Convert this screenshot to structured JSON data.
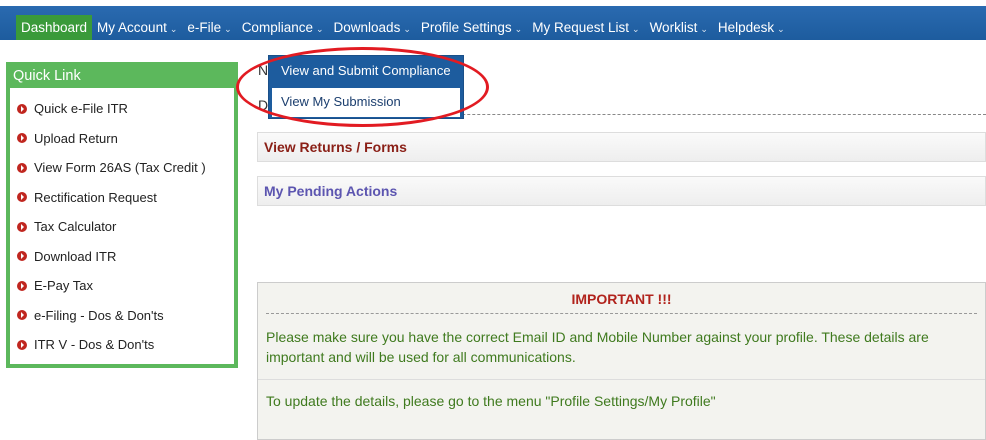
{
  "nav": {
    "items": [
      {
        "label": "Dashboard",
        "caret": ""
      },
      {
        "label": "My Account",
        "caret": "⌄"
      },
      {
        "label": "e-File",
        "caret": "⌄"
      },
      {
        "label": "Compliance",
        "caret": "⌄"
      },
      {
        "label": "Downloads",
        "caret": "⌄"
      },
      {
        "label": "Profile Settings",
        "caret": "⌄"
      },
      {
        "label": "My Request List",
        "caret": "⌄"
      },
      {
        "label": "Worklist",
        "caret": "⌄"
      },
      {
        "label": "Helpdesk",
        "caret": "⌄"
      }
    ]
  },
  "quick_link": {
    "title": "Quick Link",
    "items": [
      {
        "label": "Quick e-File ITR"
      },
      {
        "label": "Upload Return"
      },
      {
        "label": "View Form 26AS (Tax Credit )"
      },
      {
        "label": "Rectification Request"
      },
      {
        "label": "Tax Calculator"
      },
      {
        "label": "Download ITR"
      },
      {
        "label": "E-Pay Tax"
      },
      {
        "label": "e-Filing - Dos & Don'ts"
      },
      {
        "label": "ITR V - Dos & Don'ts"
      }
    ]
  },
  "main": {
    "fragment_top": "N",
    "fragment_d": "D",
    "panels": {
      "returns": "View Returns / Forms",
      "pending": "My Pending Actions"
    },
    "important": {
      "title": "IMPORTANT !!!",
      "message1": "Please make sure you have the correct Email ID and Mobile Number against your profile. These details are important and will be used for all communications.",
      "message2": "To update the details, please go to the menu \"Profile Settings/My Profile\""
    }
  },
  "compliance_menu": {
    "items": [
      {
        "label": "View and Submit Compliance"
      },
      {
        "label": "View My Submission"
      }
    ]
  },
  "colors": {
    "nav": "#1d5c9e",
    "active": "#3a9a3a",
    "quick_border": "#5cb85c",
    "highlight": "#e21b22"
  }
}
